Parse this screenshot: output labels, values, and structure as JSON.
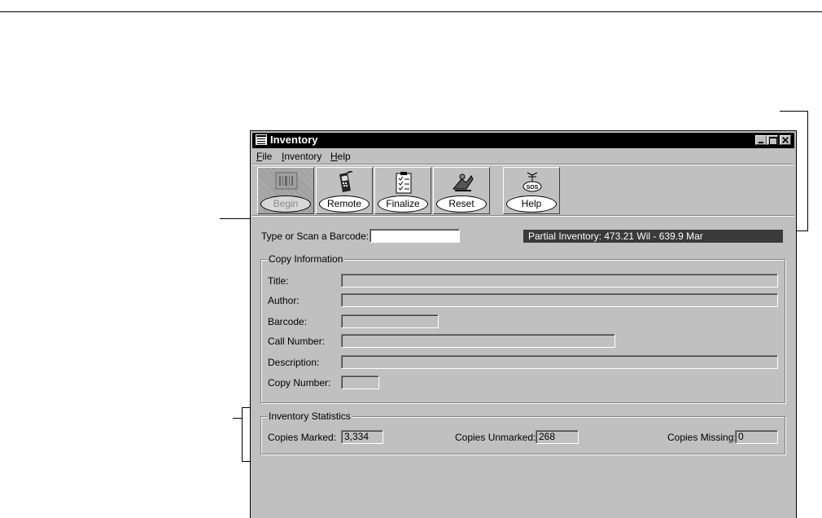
{
  "window": {
    "title": "Inventory"
  },
  "menu": [
    {
      "accel": "F",
      "rest": "ile"
    },
    {
      "accel": "I",
      "rest": "nventory"
    },
    {
      "accel": "H",
      "rest": "elp"
    }
  ],
  "toolbar": {
    "begin_label": "Begin",
    "remote_label": "Remote",
    "finalize_label": "Finalize",
    "reset_label": "Reset",
    "help_label": "Help"
  },
  "barcode_entry": {
    "label": "Type or Scan a Barcode:",
    "value": ""
  },
  "status_text": "Partial Inventory: 473.21 Wil - 639.9 Mar",
  "copy_info": {
    "legend": "Copy Information",
    "title_label": "Title:",
    "author_label": "Author:",
    "barcode_label": "Barcode:",
    "call_number_label": "Call Number:",
    "description_label": "Description:",
    "copy_number_label": "Copy Number:"
  },
  "stats": {
    "legend": "Inventory Statistics",
    "marked_label": "Copies Marked:",
    "marked_value": "3,334",
    "unmarked_label": "Copies Unmarked:",
    "unmarked_value": "268",
    "missing_label": "Copies Missing:",
    "missing_value": "0"
  }
}
